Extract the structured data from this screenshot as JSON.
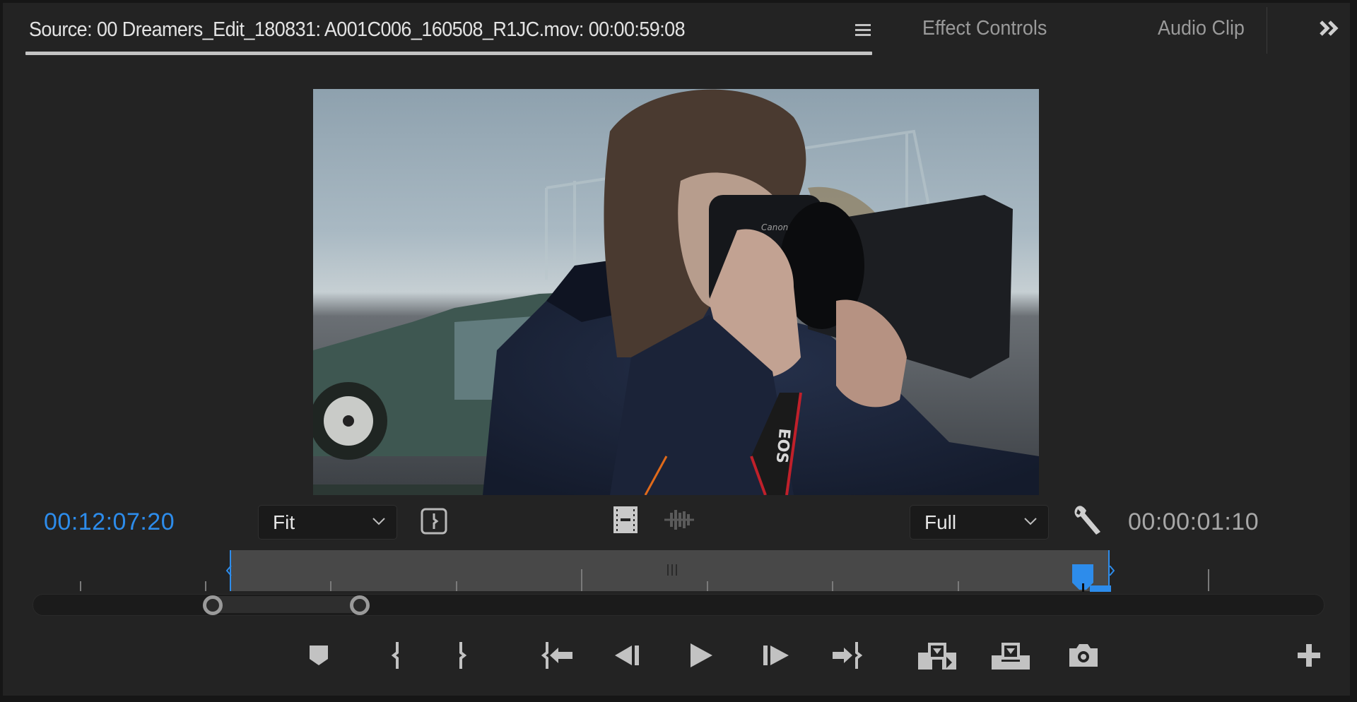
{
  "header": {
    "tabs": [
      {
        "label": "Source: 00 Dreamers_Edit_180831: A001C006_160508_R1JC.mov: 00:00:59:08",
        "active": true
      },
      {
        "label": "Effect Controls",
        "active": false
      },
      {
        "label": "Audio Clip",
        "active": false
      }
    ],
    "menu_icon": "hamburger-menu-icon",
    "overflow_icon": "double-chevron-right-icon"
  },
  "viewer": {
    "frame_description": "Man with long hair in navy parka shooting with a Canon EOS camera; green off-road vehicle in background under overcast sky",
    "strap_text": "EOS"
  },
  "controls": {
    "playhead_timecode": "00:12:07:20",
    "zoom_dropdown": {
      "value": "Fit"
    },
    "resolution_dropdown": {
      "value": "Full"
    },
    "duration_timecode": "00:00:01:10",
    "icons": [
      "insert-overwrite-toggle-icon",
      "drag-video-only-icon",
      "drag-audio-only-icon",
      "settings-wrench-icon"
    ]
  },
  "timeline": {
    "accent_color": "#2d8ceb",
    "in_range_shaded": true
  },
  "transport": {
    "buttons": [
      {
        "name": "add-marker",
        "tooltip": "Add Marker"
      },
      {
        "name": "mark-in",
        "tooltip": "Mark In"
      },
      {
        "name": "mark-out",
        "tooltip": "Mark Out"
      },
      {
        "name": "go-to-in",
        "tooltip": "Go to In"
      },
      {
        "name": "step-back",
        "tooltip": "Step Back 1 Frame"
      },
      {
        "name": "play-stop",
        "tooltip": "Play-Stop Toggle"
      },
      {
        "name": "step-forward",
        "tooltip": "Step Forward 1 Frame"
      },
      {
        "name": "go-to-out",
        "tooltip": "Go to Out"
      },
      {
        "name": "insert",
        "tooltip": "Insert"
      },
      {
        "name": "overwrite",
        "tooltip": "Overwrite"
      },
      {
        "name": "export-frame",
        "tooltip": "Export Frame"
      },
      {
        "name": "button-editor",
        "tooltip": "Button Editor"
      }
    ]
  }
}
